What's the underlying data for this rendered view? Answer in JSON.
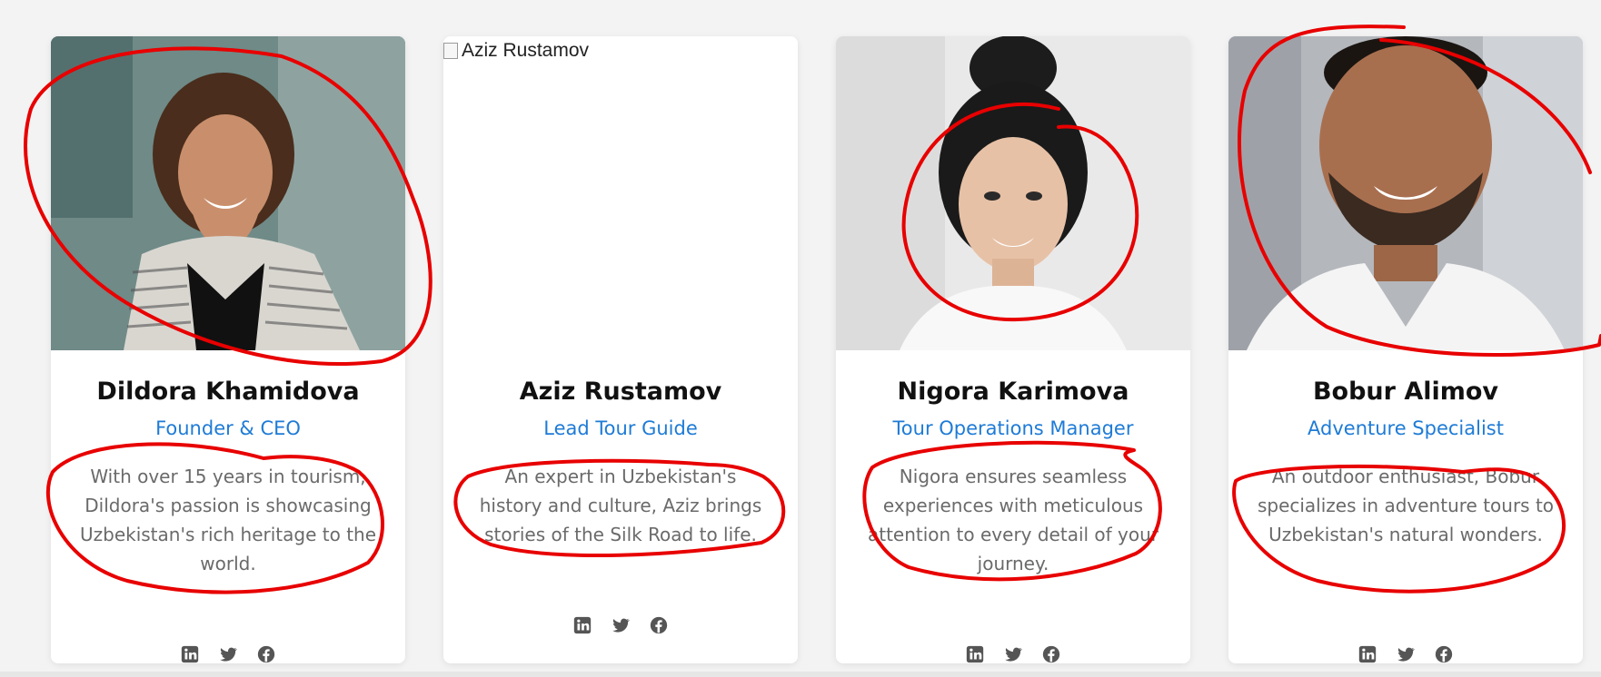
{
  "team": [
    {
      "name": "Dildora Khamidova",
      "role": "Founder & CEO",
      "bio": "With over 15 years in tourism, Dildora's passion is showcasing Uzbekistan's rich heritage to the world.",
      "photo": "woman-curly-hair-photo",
      "image_loaded": true
    },
    {
      "name": "Aziz Rustamov",
      "role": "Lead Tour Guide",
      "bio": "An expert in Uzbekistan's history and culture, Aziz brings stories of the Silk Road to life.",
      "photo_alt": "Aziz Rustamov",
      "image_loaded": false
    },
    {
      "name": "Nigora Karimova",
      "role": "Tour Operations Manager",
      "bio": "Nigora ensures seamless experiences with meticulous attention to every detail of your journey.",
      "photo": "woman-hair-bun-photo",
      "image_loaded": true
    },
    {
      "name": "Bobur Alimov",
      "role": "Adventure Specialist",
      "bio": "An outdoor enthusiast, Bobur specializes in adventure tours to Uzbekistan's natural wonders.",
      "photo": "man-beard-smiling-photo",
      "image_loaded": true
    }
  ],
  "social_icons": [
    "linkedin-icon",
    "twitter-icon",
    "facebook-icon"
  ],
  "colors": {
    "role_accent": "#1e7bd6",
    "annotation_red": "#e80000",
    "card_bg": "#ffffff",
    "page_bg": "#f3f3f3"
  }
}
